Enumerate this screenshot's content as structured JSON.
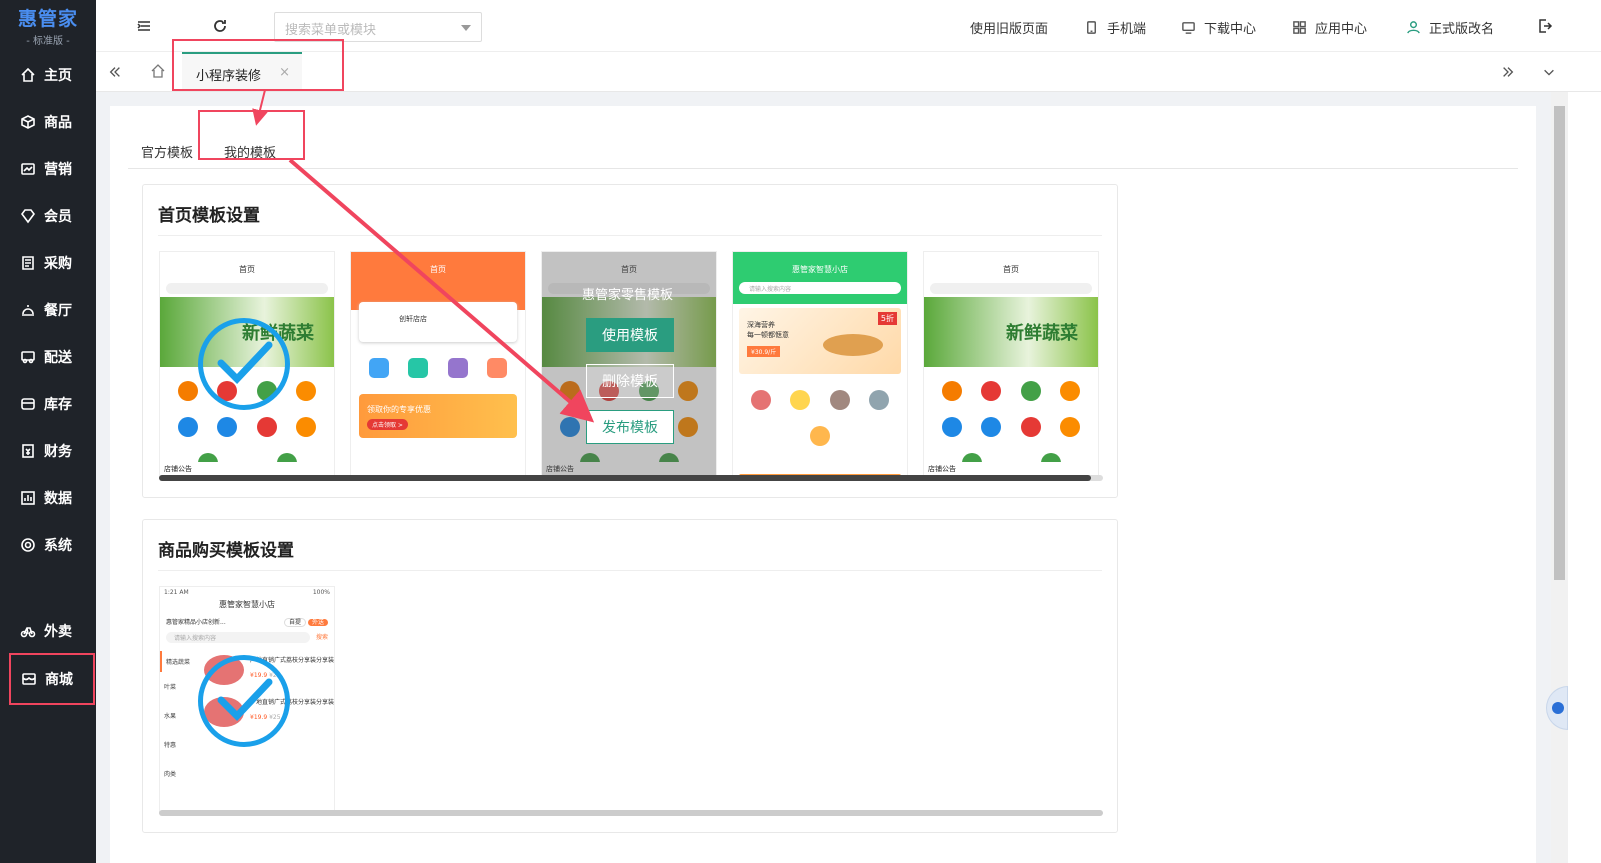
{
  "logo": {
    "title": "惠管家",
    "edition": "- 标准版 -"
  },
  "sidebar": {
    "items": [
      {
        "label": "主页",
        "icon": "home-icon"
      },
      {
        "label": "商品",
        "icon": "box-icon"
      },
      {
        "label": "营销",
        "icon": "chart-icon"
      },
      {
        "label": "会员",
        "icon": "diamond-icon"
      },
      {
        "label": "采购",
        "icon": "list-icon"
      },
      {
        "label": "餐厅",
        "icon": "bell-icon"
      },
      {
        "label": "配送",
        "icon": "truck-icon"
      },
      {
        "label": "库存",
        "icon": "warehouse-icon"
      },
      {
        "label": "财务",
        "icon": "finance-icon"
      },
      {
        "label": "数据",
        "icon": "bar-chart-icon"
      },
      {
        "label": "系统",
        "icon": "settings-icon"
      },
      {
        "label": "外卖",
        "icon": "bike-icon"
      },
      {
        "label": "商城",
        "icon": "store-icon"
      }
    ]
  },
  "topbar": {
    "search_placeholder": "搜索菜单或模块",
    "links": [
      {
        "label": "使用旧版页面"
      },
      {
        "label": "手机端",
        "icon": "phone-icon"
      },
      {
        "label": "下载中心",
        "icon": "monitor-icon"
      },
      {
        "label": "应用中心",
        "icon": "apps-icon"
      },
      {
        "label": "正式版改名",
        "icon": "user-icon"
      }
    ]
  },
  "tabs": {
    "active_label": "小程序装修",
    "close": "×"
  },
  "subtabs": {
    "official": "官方模板",
    "mine": "我的模板"
  },
  "home_section": {
    "title": "首页模板设置",
    "thumbs": [
      {
        "header": "首页",
        "banner_text": "新鲜蔬菜",
        "notice": "店铺公告"
      },
      {
        "header": "首页",
        "shop": "创轩店店",
        "promo": "领取你的专享优惠",
        "promo_btn": "点击领取 >"
      },
      {
        "header": "首页",
        "notice": "店铺公告"
      },
      {
        "header": "惠管家智慧小店",
        "search": "请输入搜索内容",
        "banner_line1": "深海营养",
        "banner_line2": "每一顿都惬意",
        "price": "¥30.9/斤",
        "tag": "5折"
      },
      {
        "header": "首页",
        "banner_text": "新鲜蔬菜",
        "notice": "店铺公告"
      }
    ],
    "overlay": {
      "title": "惠管家零售模板",
      "use": "使用模板",
      "delete": "删除模板",
      "publish": "发布模板"
    }
  },
  "goods_section": {
    "title": "商品购买模板设置",
    "thumb": {
      "time": "1:21 AM",
      "battery": "100%",
      "shop": "惠管家智慧小店",
      "address": "惠管家精品小店创新...",
      "pickup": "自提",
      "delivery": "外送",
      "search": "请输入搜索内容",
      "search_btn": "搜索",
      "categories": [
        "精选蔬菜",
        "叶菜",
        "水果",
        "特惠",
        "肉类"
      ],
      "product": "广地直销广式荔枝分享装分享装",
      "price1": "¥19.9",
      "price2": "¥25"
    }
  },
  "colors": {
    "accent": "#2a9d80",
    "highlight": "#f0455e",
    "check": "#1aa0ea"
  }
}
